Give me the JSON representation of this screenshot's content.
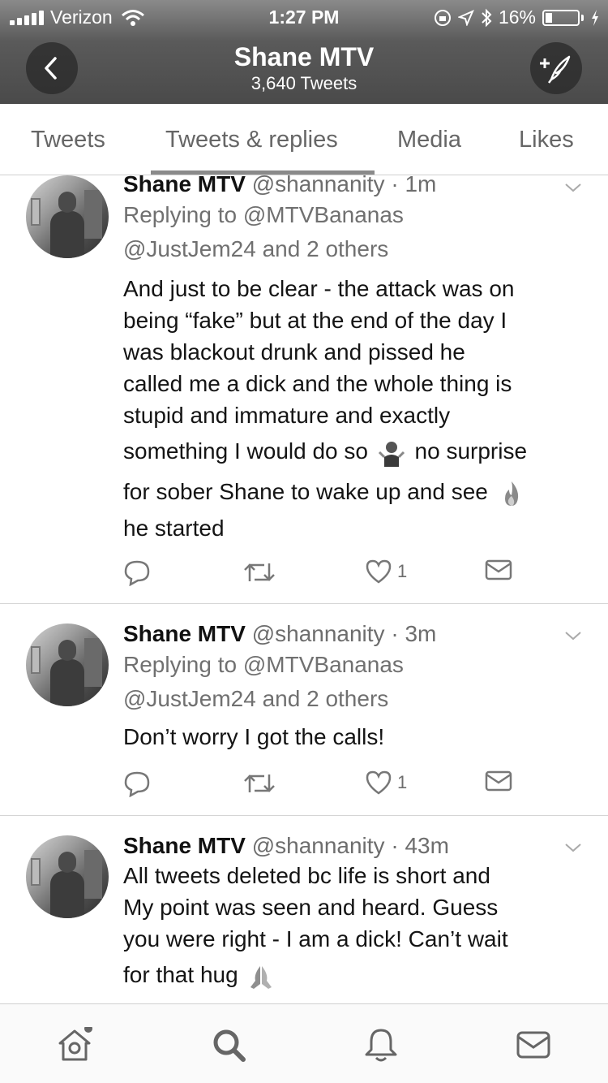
{
  "status_bar": {
    "carrier": "Verizon",
    "time": "1:27 PM",
    "battery": "16%"
  },
  "header": {
    "name": "Shane MTV",
    "tweet_count": "3,640 Tweets"
  },
  "tabs": [
    {
      "label": "Tweets"
    },
    {
      "label": "Tweets & replies"
    },
    {
      "label": "Media"
    },
    {
      "label": "Likes"
    }
  ],
  "active_tab": "Tweets & replies",
  "tweets": [
    {
      "name": "Shane MTV",
      "handle_time": "@shannanity · 1m",
      "replying_to": "Replying to @MTVBananas",
      "replying_more": "@JustJem24 and 2 others",
      "text_lines": [
        "And just to be clear - the attack was on",
        "being “fake” but at the end of the day I",
        "was blackout drunk and pissed he",
        "called me a dick and the whole thing is",
        "stupid and immature and exactly",
        "something I would do so",
        "no surprise",
        "for sober Shane to wake up and see",
        "he started"
      ],
      "likes": "1"
    },
    {
      "name": "Shane MTV",
      "handle_time": "@shannanity · 3m",
      "replying_to": "Replying to @MTVBananas",
      "replying_more": "@JustJem24 and 2 others",
      "text_lines": [
        "Don’t worry I got the calls!"
      ],
      "likes": "1"
    },
    {
      "name": "Shane MTV",
      "handle_time": "@shannanity · 43m",
      "text_lines": [
        "All tweets deleted bc life is short and",
        "My point was seen and heard.  Guess",
        "you were right - I am a dick! Can’t wait",
        "for that hug"
      ]
    }
  ],
  "icons": {
    "header": [
      "back-arrow-icon",
      "compose-tweet-icon"
    ],
    "actions": [
      "reply-icon",
      "retweet-icon",
      "like-heart-icon",
      "direct-message-icon"
    ],
    "emoji": [
      "shrug-emoji-icon",
      "fire-emoji-icon",
      "praying-hands-emoji-icon"
    ],
    "bottom_nav": [
      "home-icon",
      "search-icon",
      "notifications-icon",
      "messages-icon"
    ]
  }
}
